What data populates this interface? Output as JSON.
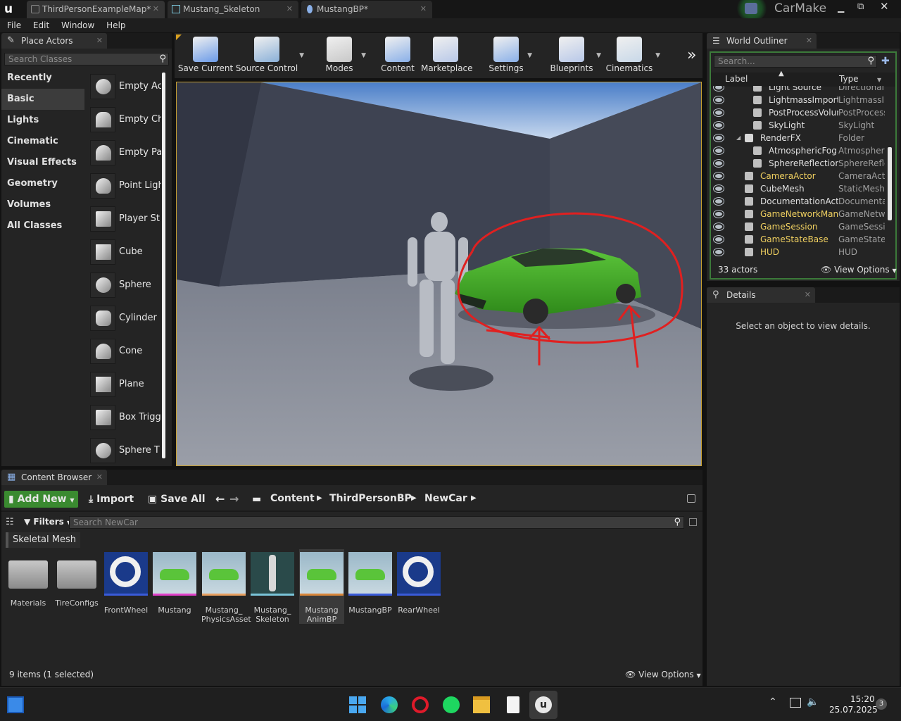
{
  "window": {
    "tabs": [
      {
        "label": "ThirdPersonExampleMap*"
      },
      {
        "label": "Mustang_Skeleton"
      },
      {
        "label": "MustangBP*"
      }
    ],
    "project_name": "CarMake"
  },
  "menu": [
    "File",
    "Edit",
    "Window",
    "Help"
  ],
  "place_actors": {
    "title": "Place Actors",
    "search_placeholder": "Search Classes",
    "categories": [
      "Recently Placed",
      "Basic",
      "Lights",
      "Cinematic",
      "Visual Effects",
      "Geometry",
      "Volumes",
      "All Classes"
    ],
    "selected_category": "Basic",
    "items": [
      "Empty Ac",
      "Empty Ch",
      "Empty Pa",
      "Point Ligh",
      "Player St",
      "Cube",
      "Sphere",
      "Cylinder",
      "Cone",
      "Plane",
      "Box Trigg",
      "Sphere T"
    ]
  },
  "toolbar": {
    "buttons": [
      "Save Current",
      "Source Control",
      "Modes",
      "Content",
      "Marketplace",
      "Settings",
      "Blueprints",
      "Cinematics"
    ]
  },
  "outliner": {
    "title": "World Outliner",
    "search_placeholder": "Search...",
    "col_label": "Label",
    "col_type": "Type",
    "rows": [
      {
        "label": "Light Source",
        "type": "DirectionalL",
        "indent": 2,
        "highlight": false
      },
      {
        "label": "LightmassImporta",
        "type": "LightmassIn",
        "indent": 2,
        "highlight": false
      },
      {
        "label": "PostProcessVolun",
        "type": "PostProcess",
        "indent": 2,
        "highlight": false
      },
      {
        "label": "SkyLight",
        "type": "SkyLight",
        "indent": 2,
        "highlight": false
      },
      {
        "label": "RenderFX",
        "type": "Folder",
        "indent": 1,
        "highlight": false
      },
      {
        "label": "AtmosphericFog",
        "type": "Atmospheric",
        "indent": 2,
        "highlight": false
      },
      {
        "label": "SphereReflectionC",
        "type": "SphereRefle",
        "indent": 2,
        "highlight": false
      },
      {
        "label": "CameraActor",
        "type": "CameraActo",
        "indent": 1,
        "highlight": true
      },
      {
        "label": "CubeMesh",
        "type": "StaticMeshA",
        "indent": 1,
        "highlight": false
      },
      {
        "label": "DocumentationActor",
        "type": "Documentat",
        "indent": 1,
        "highlight": false
      },
      {
        "label": "GameNetworkManag",
        "type": "GameNetwo",
        "indent": 1,
        "highlight": true
      },
      {
        "label": "GameSession",
        "type": "GameSessio",
        "indent": 1,
        "highlight": true
      },
      {
        "label": "GameStateBase",
        "type": "GameStateB",
        "indent": 1,
        "highlight": true
      },
      {
        "label": "HUD",
        "type": "HUD",
        "indent": 1,
        "highlight": true
      }
    ],
    "count": "33 actors",
    "view_options": "View Options"
  },
  "details": {
    "title": "Details",
    "empty_msg": "Select an object to view details."
  },
  "content_browser": {
    "title": "Content Browser",
    "add_new": "Add New",
    "import": "Import",
    "save_all": "Save All",
    "breadcrumb": [
      "Content",
      "ThirdPersonBP",
      "NewCar"
    ],
    "filters": "Filters",
    "search_placeholder": "Search NewCar",
    "filter_chip": "Skeletal Mesh",
    "assets": [
      {
        "name": "Materials",
        "kind": "folder",
        "bar": "#00000000"
      },
      {
        "name": "TireConfigs",
        "kind": "folder",
        "bar": "#00000000"
      },
      {
        "name": "FrontWheel",
        "kind": "wheel",
        "bar": "#3a5bd8"
      },
      {
        "name": "Mustang",
        "kind": "car",
        "bar": "#e040c8"
      },
      {
        "name": "Mustang_ PhysicsAsset",
        "kind": "car",
        "bar": "#e8a060"
      },
      {
        "name": "Mustang_ Skeleton",
        "kind": "skeleton",
        "bar": "#7ac4d8"
      },
      {
        "name": "Mustang AnimBP",
        "kind": "car",
        "bar": "#d8863a"
      },
      {
        "name": "MustangBP",
        "kind": "car",
        "bar": "#3a5bd8"
      },
      {
        "name": "RearWheel",
        "kind": "wheel",
        "bar": "#3a5bd8"
      }
    ],
    "selected_asset": "Mustang AnimBP",
    "status": "9 items (1 selected)",
    "view_options": "View Options"
  },
  "taskbar": {
    "time": "15:20",
    "date": "25.07.2025",
    "notification_count": "3"
  }
}
